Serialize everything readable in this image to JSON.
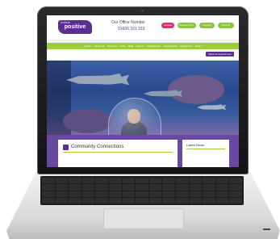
{
  "site": {
    "logo_text": "positive",
    "logo_small": "Autism",
    "office_label": "Our Office Number",
    "office_number": "01606 331 333",
    "header_buttons": [
      "Contact",
      "Referral Form",
      "Support",
      "Parents"
    ],
    "nav_items": [
      "Home",
      "About Us",
      "Services",
      "Jobs",
      "Blog",
      "Events",
      "Testimonials",
      "Useful Links",
      "Contact Us",
      "Shop"
    ],
    "book_link": "Book an Appointment",
    "community_title": "Community Connections",
    "side_title": "Latest News"
  },
  "colors": {
    "brand_purple": "#5a2d91",
    "nav_green": "#9ccc3c",
    "accent_pink": "#d6336c"
  }
}
